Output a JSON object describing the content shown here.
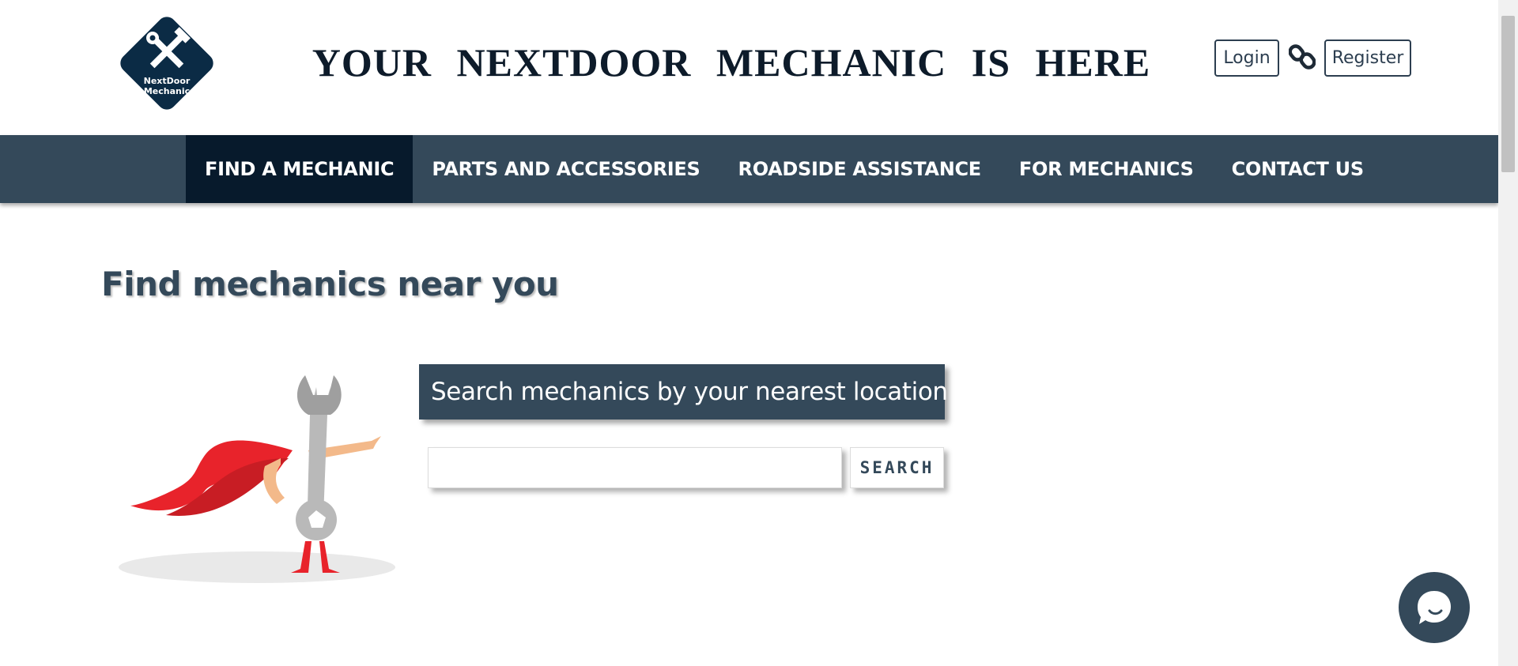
{
  "header": {
    "logo_text_line1": "NextDoor",
    "logo_text_line2": "Mechanic",
    "tagline": "YOUR NEXTDOOR MECHANIC IS HERE",
    "login_label": "Login",
    "register_label": "Register",
    "link_icon": "link-icon"
  },
  "nav": {
    "items": [
      {
        "label": "FIND A MECHANIC",
        "active": true
      },
      {
        "label": "PARTS AND ACCESSORIES",
        "active": false
      },
      {
        "label": "ROADSIDE ASSISTANCE",
        "active": false
      },
      {
        "label": "FOR MECHANICS",
        "active": false
      },
      {
        "label": "CONTACT US",
        "active": false
      }
    ]
  },
  "main": {
    "title": "Find mechanics near you",
    "search_heading": "Search mechanics by your nearest location",
    "search_value": "",
    "search_button_label": "SEARCH"
  },
  "colors": {
    "navbar": "#34495a",
    "nav_active": "#071a2c",
    "logo": "#0b2b45",
    "hero_cape": "#e8232b"
  },
  "chat": {
    "icon": "chat-bubble-icon"
  }
}
